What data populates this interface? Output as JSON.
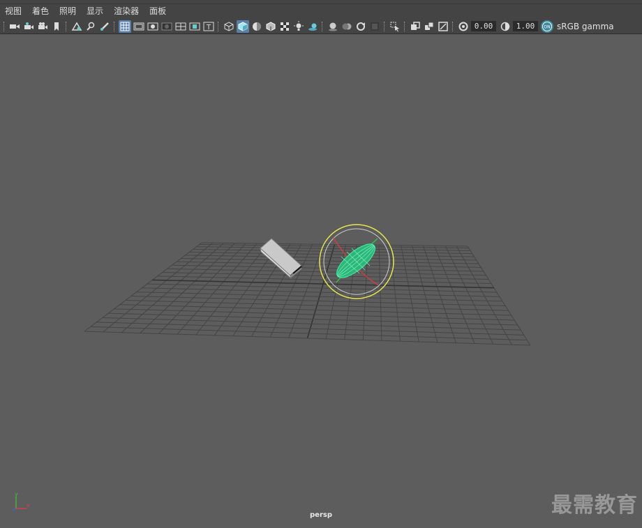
{
  "menubar": {
    "items": [
      {
        "label": "视图"
      },
      {
        "label": "着色"
      },
      {
        "label": "照明"
      },
      {
        "label": "显示"
      },
      {
        "label": "渲染器"
      },
      {
        "label": "面板"
      }
    ]
  },
  "toolbar": {
    "exposure_value": "0.00",
    "gamma_value": "1.00",
    "color_space_label": "sRGB gamma"
  },
  "viewport": {
    "camera_label": "persp",
    "axis_y_label": "y",
    "axis_x_label": "x"
  },
  "watermark": "最需教育",
  "colors": {
    "viewport_bg": "#5d5d5d",
    "grid_line": "#454545",
    "selection_green": "#3de8a0",
    "manipulator_yellow": "#e8e84a",
    "active_icon": "#5a7fa8"
  }
}
